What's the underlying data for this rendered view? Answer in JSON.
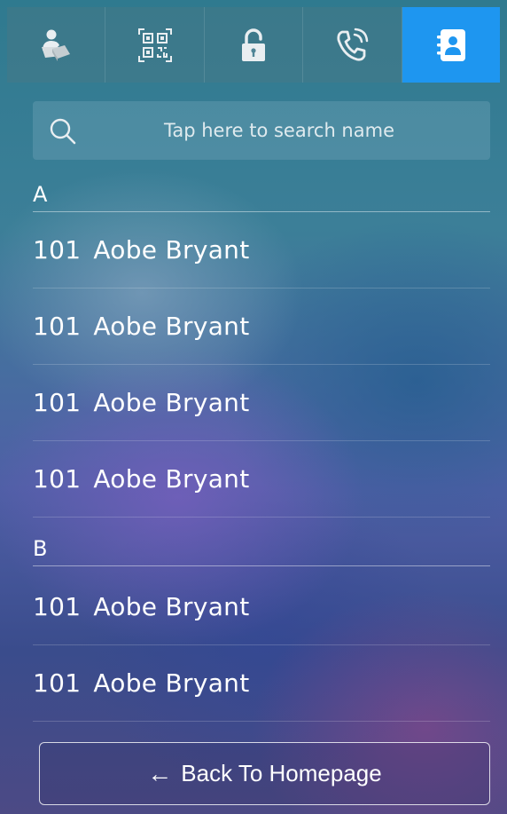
{
  "tabs": [
    {
      "icon": "resident-icon",
      "active": false
    },
    {
      "icon": "qr-code-icon",
      "active": false
    },
    {
      "icon": "unlock-icon",
      "active": false
    },
    {
      "icon": "phone-call-icon",
      "active": false
    },
    {
      "icon": "contacts-icon",
      "active": true
    }
  ],
  "accent_color": "#1e96f0",
  "search": {
    "placeholder": "Tap here to search name",
    "icon": "search-icon"
  },
  "sections": [
    {
      "letter": "A",
      "contacts": [
        {
          "number": "101",
          "name": "Aobe Bryant"
        },
        {
          "number": "101",
          "name": "Aobe Bryant"
        },
        {
          "number": "101",
          "name": "Aobe Bryant"
        },
        {
          "number": "101",
          "name": "Aobe Bryant"
        }
      ]
    },
    {
      "letter": "B",
      "contacts": [
        {
          "number": "101",
          "name": "Aobe Bryant"
        },
        {
          "number": "101",
          "name": "Aobe Bryant"
        }
      ]
    }
  ],
  "back_button": {
    "arrow": "←",
    "label": "Back To Homepage"
  }
}
